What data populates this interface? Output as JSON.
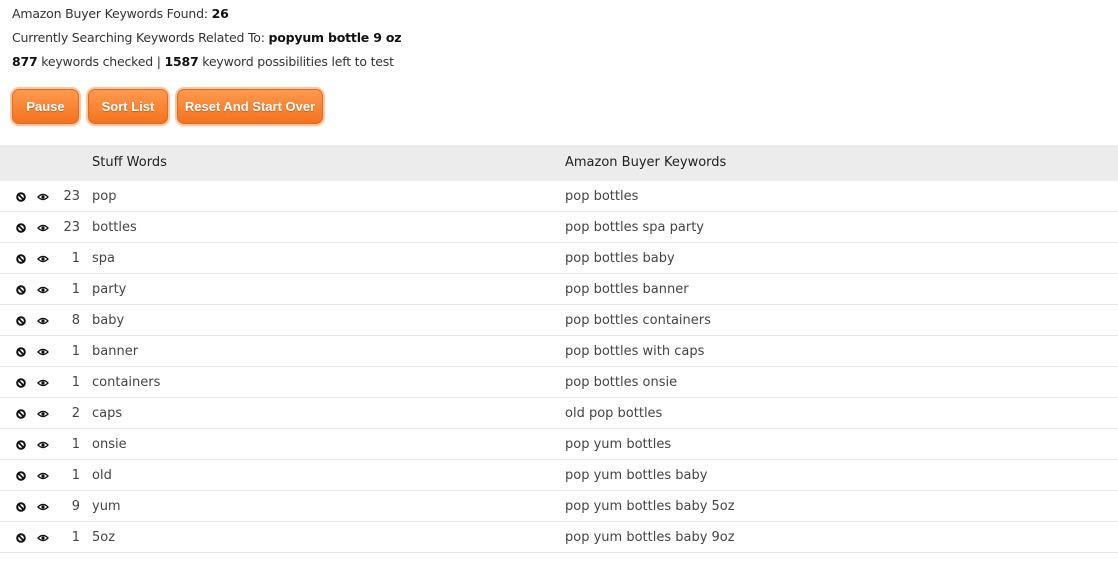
{
  "status": {
    "found_label": "Amazon Buyer Keywords Found:",
    "found_count": "26",
    "searching_label": "Currently Searching Keywords Related To:",
    "searching_term": "popyum bottle 9 oz",
    "checked_count": "877",
    "checked_label": "keywords checked |",
    "left_count": "1587",
    "left_label": "keyword possibilities left to test"
  },
  "buttons": {
    "pause": "Pause",
    "sort": "Sort List",
    "reset": "Reset And Start Over"
  },
  "table": {
    "col_stuff": "Stuff Words",
    "col_keywords": "Amazon Buyer Keywords",
    "stuff_words": [
      {
        "count": "23",
        "word": "pop"
      },
      {
        "count": "23",
        "word": "bottles"
      },
      {
        "count": "1",
        "word": "spa"
      },
      {
        "count": "1",
        "word": "party"
      },
      {
        "count": "8",
        "word": "baby"
      },
      {
        "count": "1",
        "word": "banner"
      },
      {
        "count": "1",
        "word": "containers"
      },
      {
        "count": "2",
        "word": "caps"
      },
      {
        "count": "1",
        "word": "onsie"
      },
      {
        "count": "1",
        "word": "old"
      },
      {
        "count": "9",
        "word": "yum"
      },
      {
        "count": "1",
        "word": "5oz"
      }
    ],
    "keywords": [
      "pop bottles",
      "pop bottles spa party",
      "pop bottles baby",
      "pop bottles banner",
      "pop bottles containers",
      "pop bottles with caps",
      "pop bottles onsie",
      "old pop bottles",
      "pop yum bottles",
      "pop yum bottles baby",
      "pop yum bottles baby 5oz",
      "pop yum bottles baby 9oz"
    ]
  },
  "icons": {
    "ban": "ban-icon",
    "eye": "eye-icon"
  },
  "colors": {
    "button": "#f5721f",
    "header_bg": "#ececec"
  }
}
